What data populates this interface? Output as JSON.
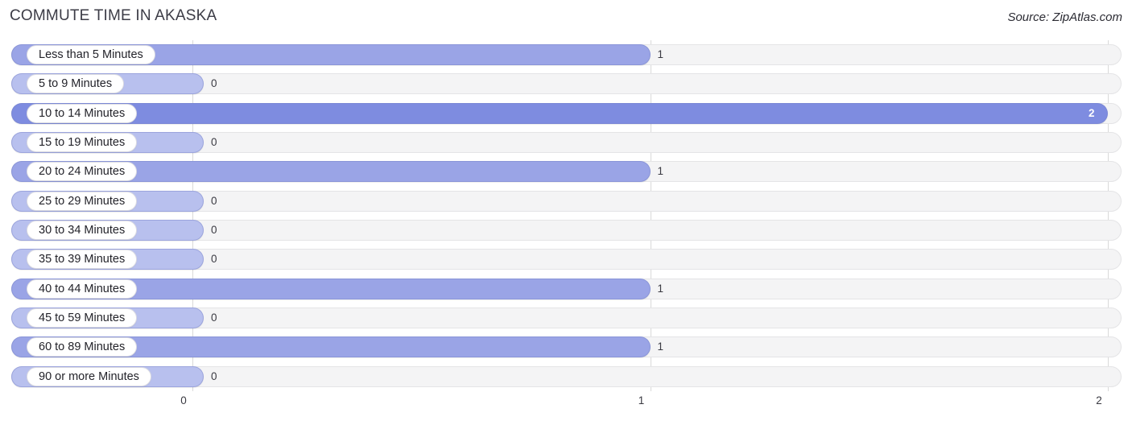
{
  "header": {
    "title": "COMMUTE TIME IN AKASKA",
    "source": "Source: ZipAtlas.com"
  },
  "colors": {
    "bar_value_1": "#9aa4e6",
    "bar_value_2": "#7e8ce0",
    "bar_value_0": "#b8c0ee",
    "track": "#f4f4f5",
    "gridline": "#d9d9d9",
    "text": "#3a3a42",
    "value_in_bar": "#ffffff"
  },
  "chart_data": {
    "type": "bar",
    "orientation": "horizontal",
    "title": "COMMUTE TIME IN AKASKA",
    "xlabel": "",
    "ylabel": "",
    "xlim": [
      0,
      2
    ],
    "grid": true,
    "legend": null,
    "xticks": [
      "0",
      "1",
      "2"
    ],
    "xtick_values": [
      0,
      1,
      2
    ],
    "categories": [
      "Less than 5 Minutes",
      "5 to 9 Minutes",
      "10 to 14 Minutes",
      "15 to 19 Minutes",
      "20 to 24 Minutes",
      "25 to 29 Minutes",
      "30 to 34 Minutes",
      "35 to 39 Minutes",
      "40 to 44 Minutes",
      "45 to 59 Minutes",
      "60 to 89 Minutes",
      "90 or more Minutes"
    ],
    "values": [
      1,
      0,
      2,
      0,
      1,
      0,
      0,
      0,
      1,
      0,
      1,
      0
    ],
    "value_labels": [
      "1",
      "0",
      "2",
      "0",
      "1",
      "0",
      "0",
      "0",
      "1",
      "0",
      "1",
      "0"
    ]
  },
  "rows": [
    {
      "label": "Less than 5 Minutes",
      "value": 1,
      "value_label": "1"
    },
    {
      "label": "5 to 9 Minutes",
      "value": 0,
      "value_label": "0"
    },
    {
      "label": "10 to 14 Minutes",
      "value": 2,
      "value_label": "2"
    },
    {
      "label": "15 to 19 Minutes",
      "value": 0,
      "value_label": "0"
    },
    {
      "label": "20 to 24 Minutes",
      "value": 1,
      "value_label": "1"
    },
    {
      "label": "25 to 29 Minutes",
      "value": 0,
      "value_label": "0"
    },
    {
      "label": "30 to 34 Minutes",
      "value": 0,
      "value_label": "0"
    },
    {
      "label": "35 to 39 Minutes",
      "value": 0,
      "value_label": "0"
    },
    {
      "label": "40 to 44 Minutes",
      "value": 1,
      "value_label": "1"
    },
    {
      "label": "45 to 59 Minutes",
      "value": 0,
      "value_label": "0"
    },
    {
      "label": "60 to 89 Minutes",
      "value": 1,
      "value_label": "1"
    },
    {
      "label": "90 or more Minutes",
      "value": 0,
      "value_label": "0"
    }
  ],
  "axis": {
    "ticks": [
      {
        "label": "0",
        "value": 0
      },
      {
        "label": "1",
        "value": 1
      },
      {
        "label": "2",
        "value": 2
      }
    ]
  }
}
